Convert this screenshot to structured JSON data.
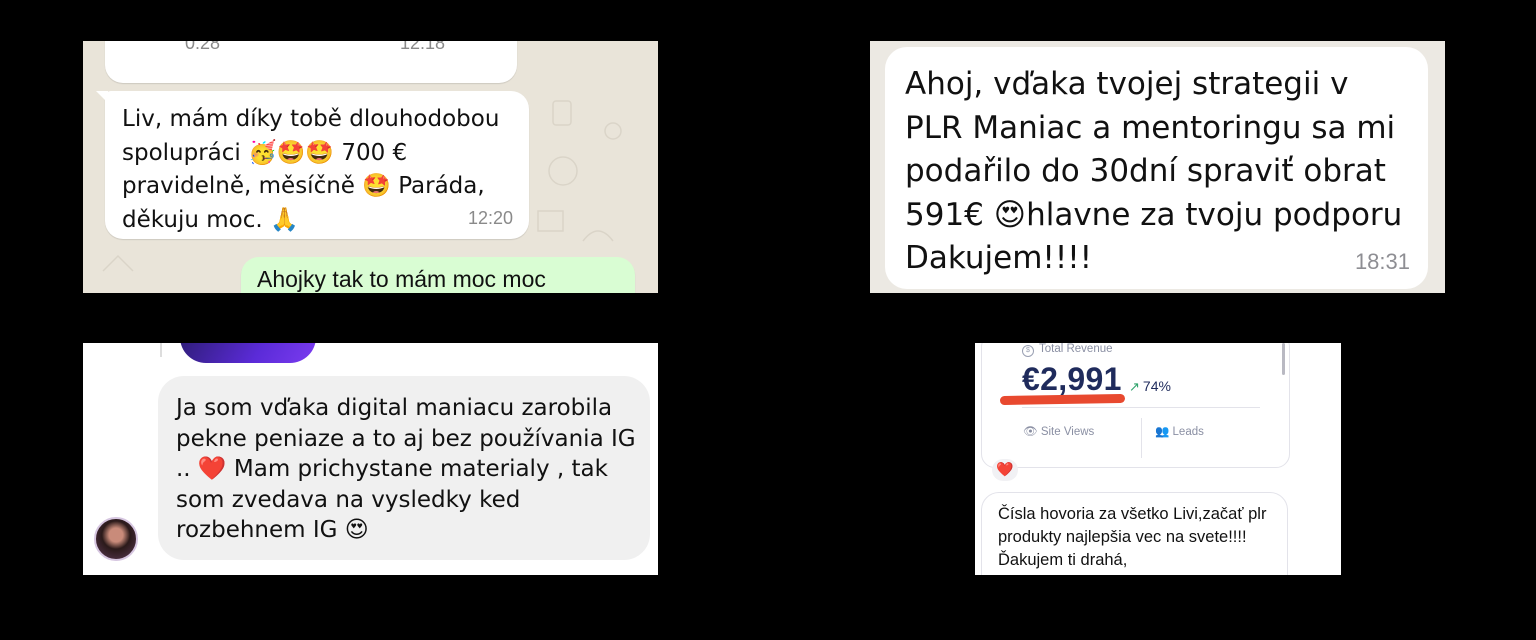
{
  "panel_whatsapp": {
    "voice_duration": "0:28",
    "voice_time": "12:18",
    "message_text": "Liv, mám díky tobě dlouhodobou spolupráci 🥳🤩🤩 700 € pravidelně, měsíčně 🤩 Paráda, děkuju moc. 🙏",
    "message_time": "12:20",
    "reply_text": "Ahojky tak to mám moc moc",
    "colors": {
      "background": "#e9e4d9",
      "outgoing_bubble": "#d9fdd3",
      "mic": "#25d366"
    }
  },
  "panel_message": {
    "text": "Ahoj, vďaka tvojej strategii v PLR Maniac a mentoringu sa mi podařilo do 30dní spraviť obrat 591€ 😍hlavne za tvoju podporu Dakujem!!!!",
    "time": "18:31"
  },
  "panel_comment": {
    "text": "Ja som vďaka digital maniacu zarobila pekne peniaze a to aj bez používania IG .. ❤️ Mam prichystane materialy , tak som zvedava na vysledky ked rozbehnem IG 😍"
  },
  "panel_dashboard": {
    "revenue_label": "Total Revenue",
    "revenue_icon": "coin-icon",
    "revenue_value": "€2,991",
    "revenue_trend": "74%",
    "site_views_label": "Site Views",
    "leads_label": "Leads",
    "reaction": "❤️",
    "comment_text": "Čísla hovoria za všetko Livi,začať plr produkty najlepšia vec na svete!!!! Ďakujem ti drahá,",
    "colors": {
      "revenue_text": "#1f2b5c",
      "underline": "#e8492f",
      "trend_up": "#2fa36b"
    }
  }
}
